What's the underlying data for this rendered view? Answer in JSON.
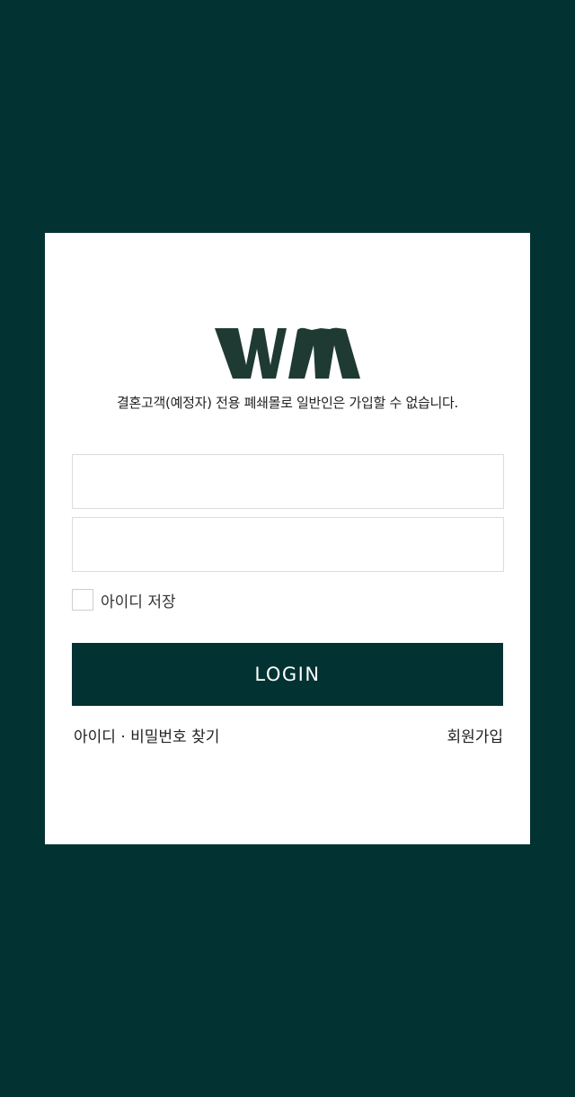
{
  "brand": {
    "logo_text": "WM",
    "logo_color": "#1f3a33"
  },
  "notice": "결혼고객(예정자) 전용 폐쇄몰로 일반인은 가입할 수 없습니다.",
  "form": {
    "id_value": "",
    "password_value": "",
    "save_id_label": "아이디 저장",
    "save_id_checked": false,
    "login_label": "LOGIN"
  },
  "links": {
    "find_label": "아이디 · 비밀번호 찾기",
    "signup_label": "회원가입"
  },
  "colors": {
    "background": "#033233",
    "card": "#ffffff",
    "button": "#033233",
    "button_text": "#ffffff"
  }
}
